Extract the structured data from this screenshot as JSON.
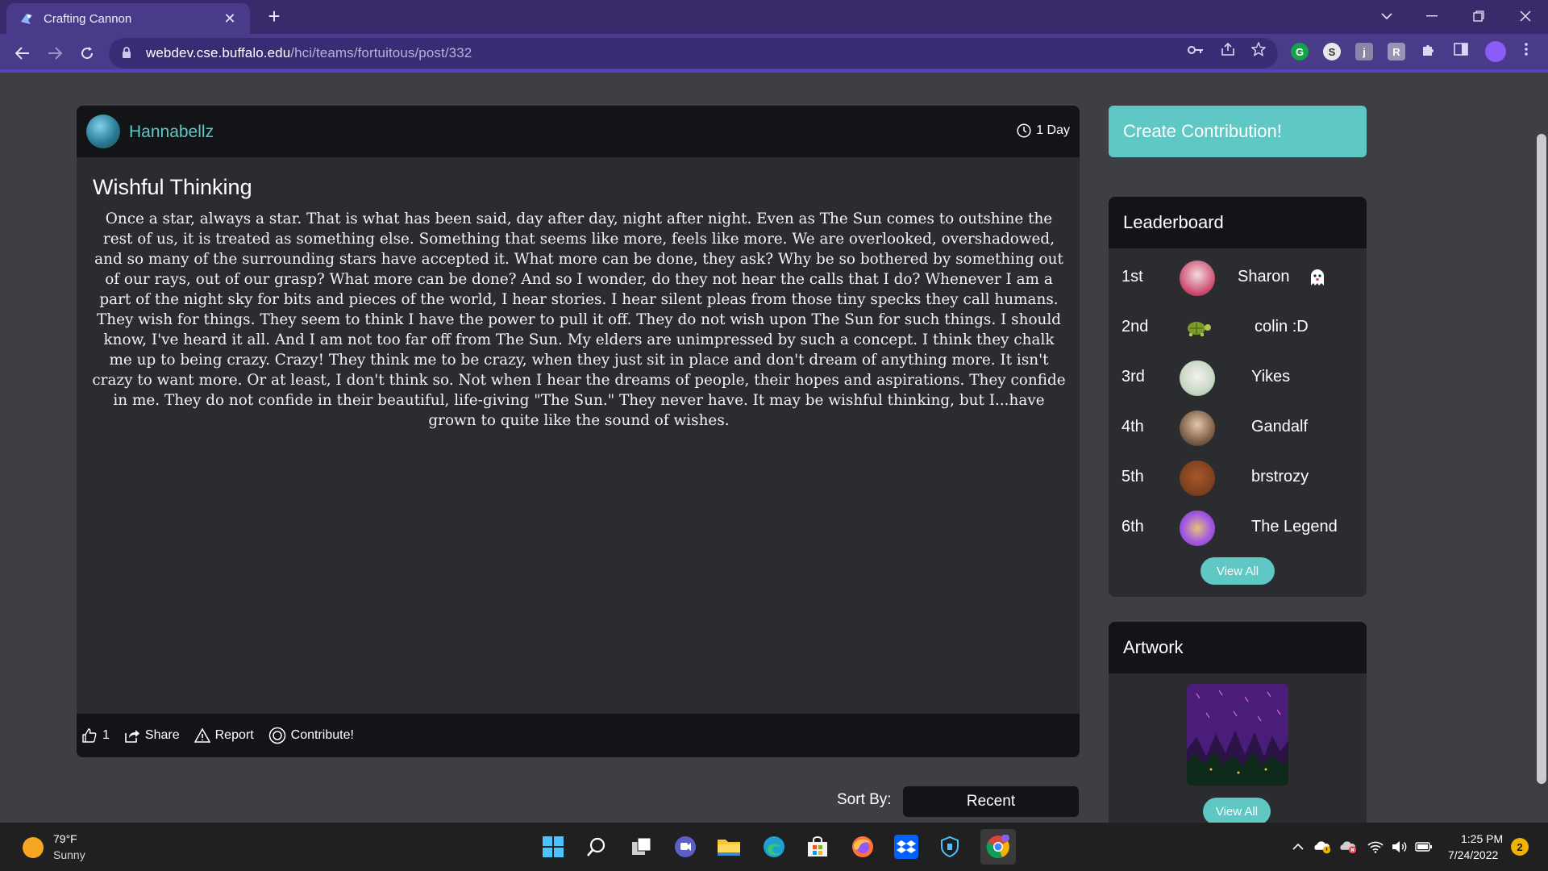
{
  "browser": {
    "tab_title": "Crafting Cannon",
    "new_tab_label": "+",
    "url_host": "webdev.cse.buffalo.edu",
    "url_path": "/hci/teams/fortuitous/post/332"
  },
  "post": {
    "author": "Hannabellz",
    "age": "1 Day",
    "title": "Wishful Thinking",
    "body": "Once a star, always a star. That is what has been said, day after day, night after night. Even as The Sun comes to outshine the rest of us, it is treated as something else. Something that seems like more, feels like more. We are overlooked, overshadowed, and so many of the surrounding stars have accepted it. What more can be done, they ask? Why be so bothered by something out of our rays, out of our grasp? What more can be done? And so I wonder, do they not hear the calls that I do? Whenever I am a part of the night sky for bits and pieces of the world, I hear stories. I hear silent pleas from those tiny specks they call humans. They wish for things. They seem to think I have the power to pull it off. They do not wish upon The Sun for such things. I should know, I've heard it all. And I am not too far off from The Sun. My elders are unimpressed by such a concept. I think they chalk me up to being crazy. Crazy! They think me to be crazy, when they just sit in place and don't dream of anything more. It isn't crazy to want more. Or at least, I don't think so. Not when I hear the dreams of people, their hopes and aspirations. They confide in me. They do not confide in their beautiful, life-giving \"The Sun.\" They never have. It may be wishful thinking, but I...have grown to quite like the sound of wishes.",
    "likes": "1",
    "share_label": "Share",
    "report_label": "Report",
    "contribute_label": "Contribute!"
  },
  "sort": {
    "label": "Sort By:",
    "value": "Recent"
  },
  "sidebar": {
    "create_label": "Create Contribution!",
    "leaderboard": {
      "title": "Leaderboard",
      "rows": [
        {
          "rank": "1st",
          "name": "Sharon",
          "avatar_color": "#c9466a"
        },
        {
          "rank": "2nd",
          "name": "colin :D",
          "avatar_color": "#6f8f2f"
        },
        {
          "rank": "3rd",
          "name": "Yikes",
          "avatar_color": "#c9d8c5"
        },
        {
          "rank": "4th",
          "name": "Gandalf",
          "avatar_color": "#8a6a52"
        },
        {
          "rank": "5th",
          "name": "brstrozy",
          "avatar_color": "#7a3e1c"
        },
        {
          "rank": "6th",
          "name": "The Legend",
          "avatar_color": "#a45be0"
        }
      ],
      "view_all": "View All"
    },
    "artwork": {
      "title": "Artwork",
      "view_all": "View All"
    }
  },
  "taskbar": {
    "temperature": "79°F",
    "condition": "Sunny",
    "time": "1:25 PM",
    "date": "7/24/2022",
    "notifications": "2"
  },
  "colors": {
    "accent": "#5fc7c4",
    "chrome": "#4a3a8a",
    "page_bg": "#3d3f44",
    "card_bg": "#2b2c30",
    "header_bg": "#131417"
  }
}
